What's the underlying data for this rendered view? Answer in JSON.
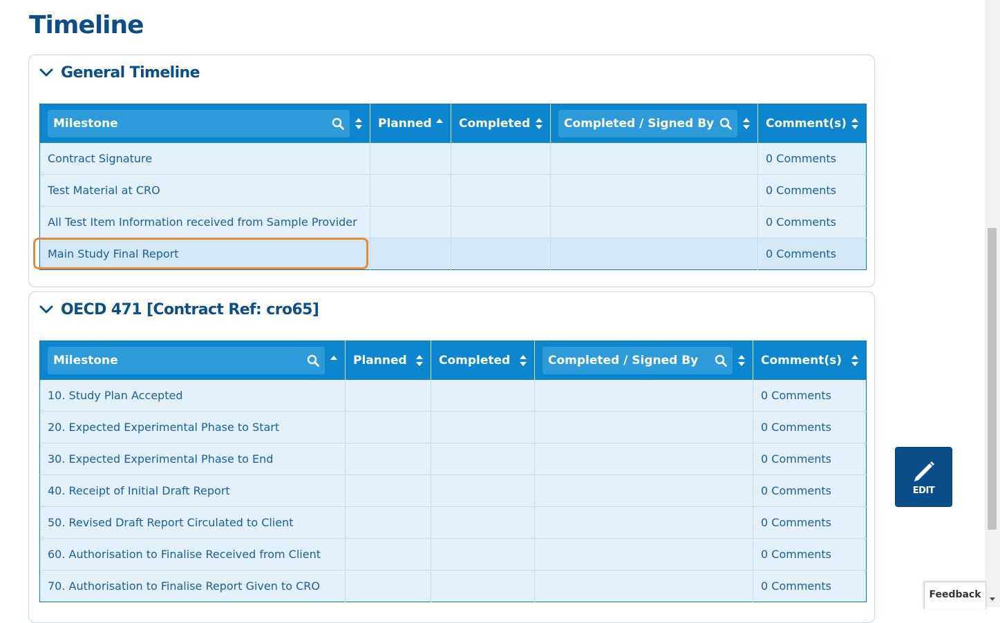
{
  "page": {
    "title": "Timeline"
  },
  "general_timeline": {
    "title": "General Timeline",
    "columns": [
      "Milestone",
      "Planned",
      "Completed",
      "Completed / Signed By",
      "Comment(s)"
    ],
    "rows": [
      {
        "milestone": "Contract Signature",
        "planned": "",
        "completed": "",
        "signed_by": "",
        "comments": "0 Comments"
      },
      {
        "milestone": "Test Material at CRO",
        "planned": "",
        "completed": "",
        "signed_by": "",
        "comments": "0 Comments"
      },
      {
        "milestone": "All Test Item Information received from Sample Provider",
        "planned": "",
        "completed": "",
        "signed_by": "",
        "comments": "0 Comments"
      },
      {
        "milestone": "Main Study Final Report",
        "planned": "",
        "completed": "",
        "signed_by": "",
        "comments": "0 Comments"
      }
    ]
  },
  "oecd_timeline": {
    "title": "OECD 471 [Contract Ref: cro65]",
    "columns": [
      "Milestone",
      "Planned",
      "Completed",
      "Completed / Signed By",
      "Comment(s)"
    ],
    "rows": [
      {
        "milestone": "10. Study Plan Accepted",
        "planned": "",
        "completed": "",
        "signed_by": "",
        "comments": "0 Comments"
      },
      {
        "milestone": "20. Expected Experimental Phase to Start",
        "planned": "",
        "completed": "",
        "signed_by": "",
        "comments": "0 Comments"
      },
      {
        "milestone": "30. Expected Experimental Phase to End",
        "planned": "",
        "completed": "",
        "signed_by": "",
        "comments": "0 Comments"
      },
      {
        "milestone": "40. Receipt of Initial Draft Report",
        "planned": "",
        "completed": "",
        "signed_by": "",
        "comments": "0 Comments"
      },
      {
        "milestone": "50. Revised Draft Report Circulated to Client",
        "planned": "",
        "completed": "",
        "signed_by": "",
        "comments": "0 Comments"
      },
      {
        "milestone": "60. Authorisation to Finalise Received from Client",
        "planned": "",
        "completed": "",
        "signed_by": "",
        "comments": "0 Comments"
      },
      {
        "milestone": "70. Authorisation to Finalise Report Given to CRO",
        "planned": "",
        "completed": "",
        "signed_by": "",
        "comments": "0 Comments"
      }
    ]
  },
  "edit_button": {
    "label": "EDIT",
    "icon": "pencil-icon"
  },
  "feedback": {
    "label": "Feedback"
  },
  "colors": {
    "title": "#0b4f8a",
    "header_bg": "#0e86cf",
    "row_bg": "#e3f1fa",
    "link_text": "#165f98",
    "highlight": "#e68a3a"
  }
}
